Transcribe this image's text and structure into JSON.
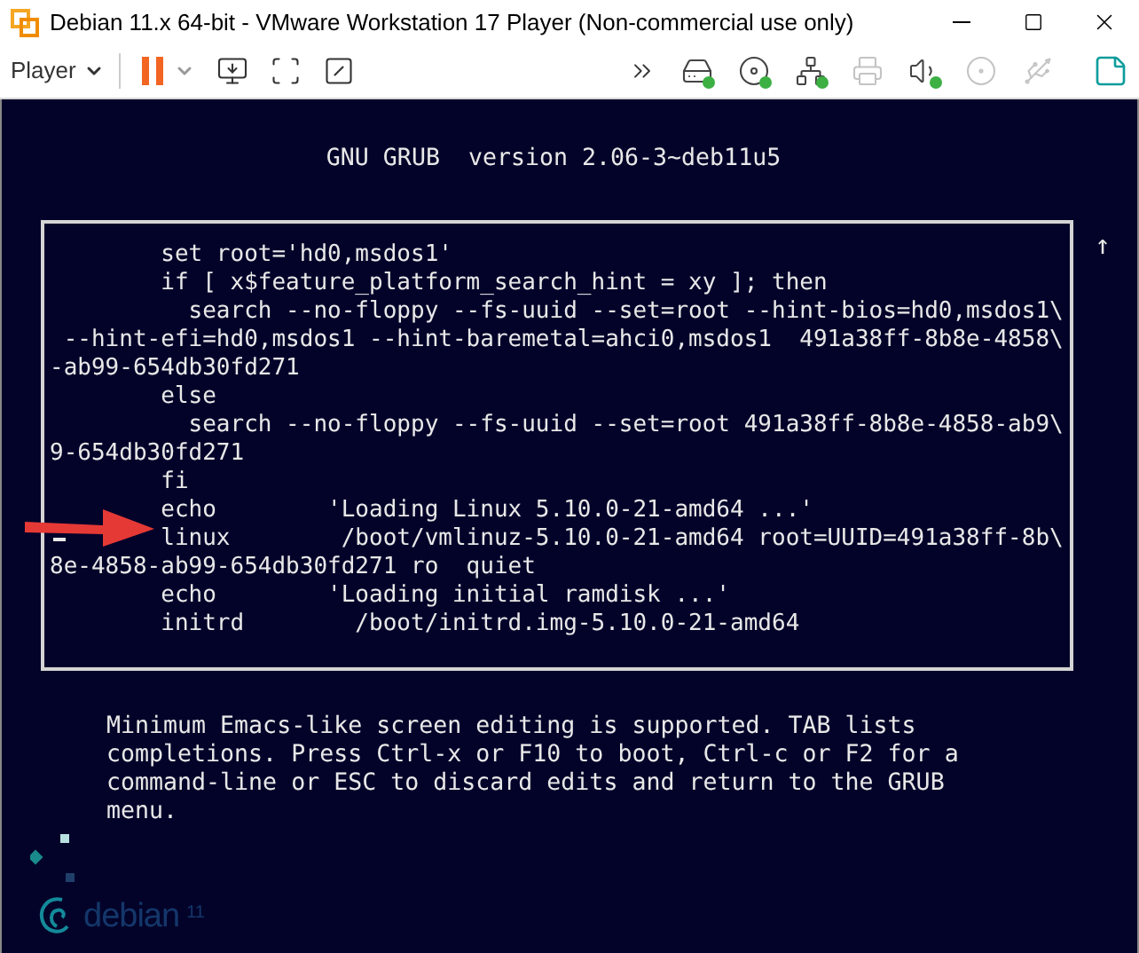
{
  "window": {
    "title": "Debian 11.x 64-bit - VMware Workstation 17 Player (Non-commercial use only)"
  },
  "toolbar": {
    "menu_label": "Player",
    "devices": [
      {
        "kind": "hdd",
        "connected": true
      },
      {
        "kind": "cd",
        "connected": true
      },
      {
        "kind": "network",
        "connected": true
      },
      {
        "kind": "printer",
        "connected": false
      },
      {
        "kind": "sound",
        "connected": true
      },
      {
        "kind": "camera",
        "connected": false
      },
      {
        "kind": "usb",
        "connected": false
      }
    ]
  },
  "grub": {
    "title": "GNU GRUB  version 2.06-3~deb11u5",
    "scroll_mark": "↑",
    "lines": [
      {
        "text": "        set root='hd0,msdos1'",
        "cursor": false
      },
      {
        "text": "        if [ x$feature_platform_search_hint = xy ]; then",
        "cursor": false
      },
      {
        "text": "          search --no-floppy --fs-uuid --set=root --hint-bios=hd0,msdos1\\",
        "cursor": false
      },
      {
        "text": " --hint-efi=hd0,msdos1 --hint-baremetal=ahci0,msdos1  491a38ff-8b8e-4858\\",
        "cursor": false
      },
      {
        "text": "-ab99-654db30fd271",
        "cursor": false
      },
      {
        "text": "        else",
        "cursor": false
      },
      {
        "text": "          search --no-floppy --fs-uuid --set=root 491a38ff-8b8e-4858-ab9\\",
        "cursor": false
      },
      {
        "text": "9-654db30fd271",
        "cursor": false
      },
      {
        "text": "        fi",
        "cursor": false
      },
      {
        "text": "        echo        'Loading Linux 5.10.0-21-amd64 ...'",
        "cursor": false
      },
      {
        "text": "        linux        /boot/vmlinuz-5.10.0-21-amd64 root=UUID=491a38ff-8b\\",
        "cursor": true
      },
      {
        "text": "8e-4858-ab99-654db30fd271 ro  quiet",
        "cursor": false
      },
      {
        "text": "        echo        'Loading initial ramdisk ...'",
        "cursor": false
      },
      {
        "text": "        initrd        /boot/initrd.img-5.10.0-21-amd64",
        "cursor": false
      }
    ],
    "help": [
      "Minimum Emacs-like screen editing is supported. TAB lists",
      "completions. Press Ctrl-x or F10 to boot, Ctrl-c or F2 for a",
      "command-line or ESC to discard edits and return to the GRUB",
      "menu."
    ]
  },
  "logo": {
    "name": "debian",
    "version": "11"
  }
}
